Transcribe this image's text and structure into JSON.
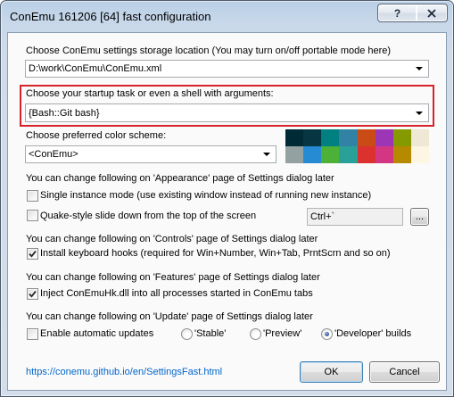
{
  "window": {
    "title": "ConEmu 161206 [64] fast configuration",
    "help_glyph": "?"
  },
  "icons": {
    "help": "help-icon",
    "close": "close-icon",
    "dropdown": "chevron-down-icon",
    "check": "checkmark-icon"
  },
  "storage": {
    "label": "Choose ConEmu settings storage location (You may turn on/off portable mode here)",
    "value": "D:\\work\\ConEmu\\ConEmu.xml"
  },
  "startup": {
    "label": "Choose your startup task or even a shell with arguments:",
    "value": "{Bash::Git bash}",
    "highlight_color": "#d8232a"
  },
  "color_scheme": {
    "label": "Choose preferred color scheme:",
    "value": "<ConEmu>",
    "palette": [
      "#002b36",
      "#073642",
      "#008080",
      "#3182a4",
      "#cb4b16",
      "#9c36b6",
      "#859900",
      "#eee8d5",
      "#93a1a1",
      "#268bd2",
      "#4cb136",
      "#2aa198",
      "#dc322f",
      "#d33682",
      "#b58900",
      "#fdf6e3"
    ]
  },
  "appearance": {
    "heading": "You can change following on 'Appearance' page of Settings dialog later",
    "single_instance": {
      "label": "Single instance mode (use existing window instead of running new instance)",
      "checked": false
    },
    "quake": {
      "label": "Quake-style slide down from the top of the screen",
      "checked": false,
      "hotkey": "Ctrl+`",
      "browse_label": "..."
    }
  },
  "controls": {
    "heading": "You can change following on 'Controls' page of Settings dialog later",
    "keyboard_hooks": {
      "label": "Install keyboard hooks (required for Win+Number, Win+Tab, PrntScrn and so on)",
      "checked": true
    }
  },
  "features": {
    "heading": "You can change following on 'Features' page of Settings dialog later",
    "inject_hook": {
      "label": "Inject ConEmuHk.dll into all processes started in ConEmu tabs",
      "checked": true
    }
  },
  "update": {
    "heading": "You can change following on 'Update' page of Settings dialog later",
    "auto_updates": {
      "label": "Enable automatic updates",
      "checked": false
    },
    "channels": [
      {
        "label": "'Stable'",
        "selected": false
      },
      {
        "label": "'Preview'",
        "selected": false
      },
      {
        "label": "'Developer' builds",
        "selected": true
      }
    ]
  },
  "footer": {
    "link": "https://conemu.github.io/en/SettingsFast.html",
    "link_color": "#0066cc",
    "ok_label": "OK",
    "cancel_label": "Cancel"
  }
}
